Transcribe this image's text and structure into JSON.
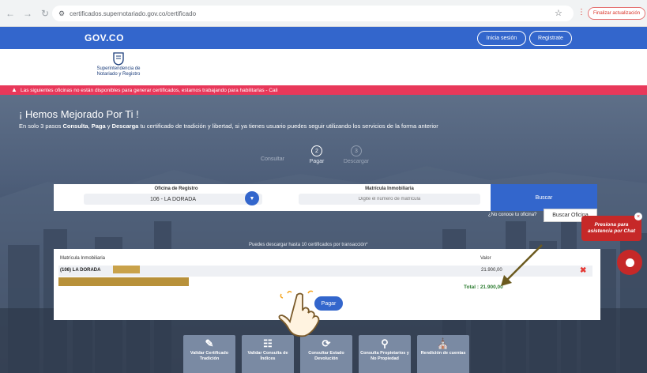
{
  "browser": {
    "url": "certificados.supernotariado.gov.co/certificado",
    "update_label": "Finalizar actualización"
  },
  "gov": {
    "logo": "GOV.CO",
    "login_label": "Inicia sesión",
    "register_label": "Registrate"
  },
  "entity": {
    "name_line1": "Superintendencia de",
    "name_line2": "Notariado y Registro"
  },
  "alert": {
    "text": "Las siguientes oficinas no están disponibles para generar certificados, estamos trabajando para habilitarlas - Cali"
  },
  "hero": {
    "title": "¡ Hemos Mejorado Por Ti !",
    "sub_pre": "En solo 3 pasos ",
    "sub_consulta": "Consulta",
    "sub_sep1": ", ",
    "sub_paga": "Paga",
    "sub_sep2": " y ",
    "sub_descarga": "Descarga",
    "sub_post": " tu certificado de tradición y libertad, si ya tienes usuario puedes seguir utilizando los servicios de la forma anterior"
  },
  "steps": [
    {
      "label": "Consultar",
      "num": "1"
    },
    {
      "label": "Pagar",
      "num": "2"
    },
    {
      "label": "Descargar",
      "num": "3"
    }
  ],
  "search": {
    "office_label": "Oficina de Registro",
    "office_value": "106 - LA DORADA",
    "matricula_label": "Matrícula Inmobiliaria",
    "matricula_placeholder": "Digite el número de matrícula",
    "buscar_label": "Buscar",
    "unknown_office": "¿No conoce tu oficina?",
    "buscar_oficina_label": "Buscar Oficina"
  },
  "cart": {
    "limit_note": "Puedes descargar hasta 10 certificados por transacción*",
    "col_matricula": "Matrícula Inmobiliaria",
    "col_valor": "Valor",
    "row_matricula": "(106) LA DORADA",
    "row_valor": "21.900,00",
    "total": "Total : 21.900,00",
    "pagar_label": "Pagar"
  },
  "services": [
    {
      "label": "Validar Certificado Tradición",
      "icon": "certificate-icon"
    },
    {
      "label": "Validar Consulta de Índices",
      "icon": "index-icon"
    },
    {
      "label": "Consultar Estado Devolución",
      "icon": "refund-icon"
    },
    {
      "label": "Consulta Propietarios y No Propiedad",
      "icon": "search-icon"
    },
    {
      "label": "Rendición de cuentas",
      "icon": "building-icon"
    }
  ],
  "chat": {
    "bubble_line1": "Presiona para",
    "bubble_line2": "asistencia por Chat"
  },
  "colors": {
    "gov_blue": "#3366cc",
    "alert_red": "#e8385a",
    "total_green": "#2e7d32",
    "chat_red": "#c62828"
  }
}
